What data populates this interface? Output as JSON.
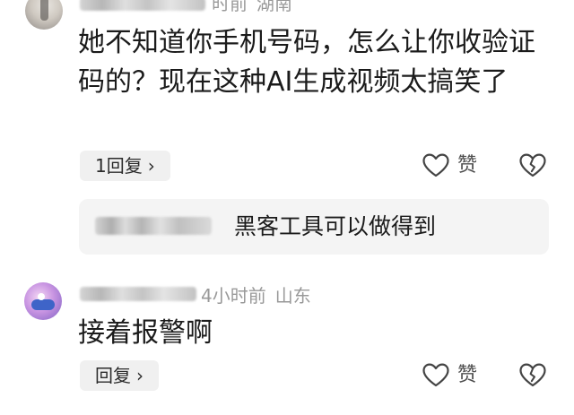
{
  "comments": [
    {
      "time_fragment": "时前",
      "location": "湖南",
      "text": "她不知道你手机号码，怎么让你收验证码的？现在这种AI生成视频太搞笑了",
      "reply_label": "1回复",
      "chevron": "›",
      "like_label": "赞"
    },
    {
      "time": "4小时前",
      "location": "山东",
      "text": "接着报警啊",
      "reply_label": "回复",
      "chevron": "›",
      "like_label": "赞"
    }
  ],
  "sub_reply": {
    "text": "黑客工具可以做得到"
  },
  "icons": {
    "like": "heart-outline-icon",
    "dislike": "broken-heart-icon"
  },
  "colors": {
    "meta_gray": "#999999",
    "reply_pill_bg": "#f0f0f0",
    "sub_reply_bg": "#f4f4f4"
  }
}
